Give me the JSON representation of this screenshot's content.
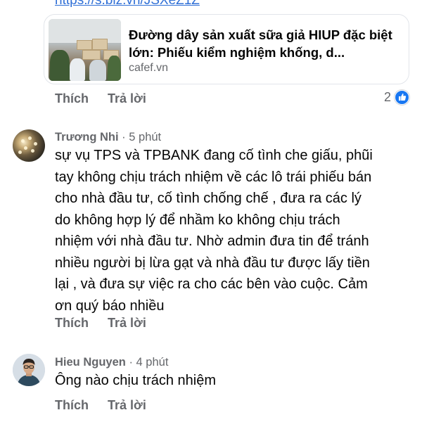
{
  "shared_link": {
    "url_text": "https://s.biz.vn/JSXeZ1Z",
    "title": "Đường dây sản xuất sữa giả HIUP đặc biệt lớn: Phiếu kiểm nghiệm khống, d...",
    "source": "cafef.vn"
  },
  "first_actions": {
    "like": "Thích",
    "reply": "Trả lời",
    "reaction_count": "2"
  },
  "comments": [
    {
      "author": "Trương Nhi",
      "time": " · 5 phút",
      "lines": [
        "sự vụ TPS và TPBANK đang cố tình che giấu, phũi",
        "tay không chịu trách nhiệm về các lô trái phiếu bán",
        "cho nhà đầu tư, cố tình chống chế , đưa ra các lý",
        "do không hợp lý để nhầm ko không chịu trách",
        "nhiệm với nhà đầu tư. Nhờ admin đưa tin để tránh",
        "nhiều người bị lừa gạt và nhà đầu tư được lấy tiền",
        "lại , và đưa sự việc ra cho các bên vào cuộc. Cảm",
        "ơn quý báo nhiều"
      ],
      "like": "Thích",
      "reply": "Trả lời"
    },
    {
      "author": "Hieu Nguyen",
      "time": " · 4 phút",
      "lines": [
        "Ông nào chịu trách nhiệm"
      ],
      "like": "Thích",
      "reply": "Trả lời"
    }
  ],
  "colors": {
    "link": "#2f6fd6",
    "secondary_text": "#65676b",
    "like_blue": "#1877f2"
  },
  "icons": {
    "reaction": "like-thumb-icon"
  }
}
